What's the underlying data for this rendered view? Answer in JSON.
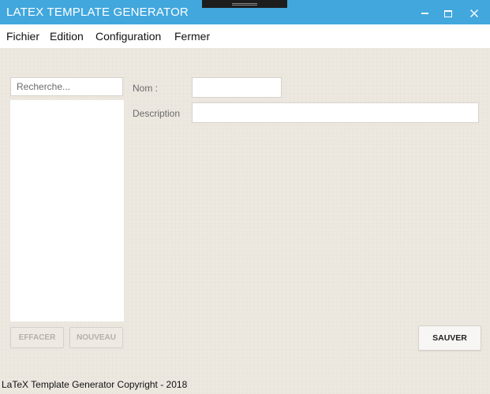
{
  "window": {
    "title": "LATEX TEMPLATE GENERATOR",
    "minimize_icon": "minimize-icon",
    "maximize_icon": "maximize-icon",
    "close_icon": "close-icon"
  },
  "menu": {
    "items": [
      {
        "label": "Fichier"
      },
      {
        "label": "Edition"
      },
      {
        "label": "Configuration"
      },
      {
        "label": "Fermer"
      }
    ]
  },
  "sidebar": {
    "search": {
      "value": "",
      "placeholder": "Recherche..."
    },
    "list_items": [],
    "buttons": {
      "clear_label": "EFFACER",
      "new_label": "NOUVEAU"
    }
  },
  "form": {
    "name": {
      "label": "Nom :",
      "value": ""
    },
    "description": {
      "label": "Description",
      "value": ""
    },
    "save_label": "SAUVER"
  },
  "footer": {
    "text": "LaTeX Template Generator Copyright - 2018"
  },
  "colors": {
    "titlebar": "#41a7dd",
    "background": "#ece7df"
  }
}
